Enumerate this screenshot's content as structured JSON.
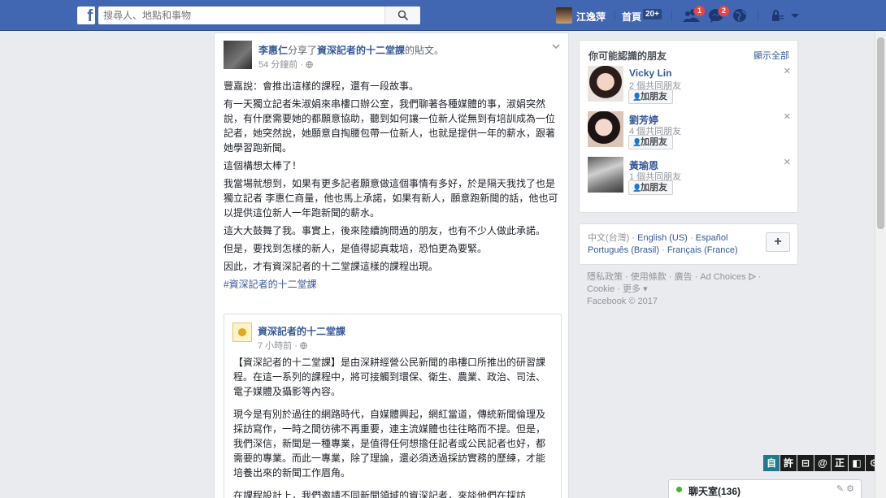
{
  "topbar": {
    "logo": "f",
    "search_placeholder": "搜尋人、地點和事物",
    "user_name": "江逸萍",
    "home_label": "首頁",
    "home_count": "20+",
    "friend_requests_count": "1",
    "messages_count": "2"
  },
  "post": {
    "author": "李惠仁",
    "shared_text": "分享了",
    "shared_page": "資深記者的十二堂課",
    "shared_suffix": "的貼文。",
    "time": "54 分鐘前 · ",
    "paragraphs": [
      "豐嘉說：會推出這樣的課程，還有一段故事。",
      "有一天獨立記者朱淑娟來串樓口辦公室，我們聊著各種媒體的事，淑娟突然說，有什麼需要她的都願意協助，聽到如何讓一位新人從無到有培訓成為一位記者，她突然說，她願意自掏腰包帶一位新人，也就是提供一年的薪水，跟著她學習跑新聞。",
      "這個構想太棒了！",
      "我當場就想到，如果有更多記者願意做這個事情有多好，於是隔天我找了也是獨立記者 李惠仁商量，他也馬上承諾，如果有新人，願意跑新聞的話，他也可以提供這位新人一年跑新聞的薪水。",
      "這大大鼓舞了我。事實上，後來陸續詢問過的朋友，也有不少人做此承諾。",
      "但是，要找到怎樣的新人，是值得認真栽培，恐怕更為要緊。",
      "因此，才有資深記者的十二堂課這樣的課程出現。"
    ],
    "hashtag": "#資深記者的十二堂課"
  },
  "shared": {
    "page_name": "資深記者的十二堂課",
    "time": "7 小時前 · ",
    "paragraphs": [
      "【資深記者的十二堂課】是由深耕經營公民新聞的串樓口所推出的研習課程。在這一系列的課程中，將可接觸到環保、衛生、農業、政治、司法、電子媒體及攝影等內容。",
      "現今是有別於過往的網路時代，自媒體興起，網紅當道，傳統新聞倫理及採訪寫作，一時之間彷彿不再重要，連主流媒體也往往略而不提。但是，我們深信，新聞是一種專業，是值得任何想擔任記者或公民記者也好，都需要的專業。而此一專業，除了理論，還必須透過採訪實務的歷練，才能培養出來的新聞工作眉角。",
      "在課程設計上，我們邀請不同新聞領域的資深記者，來談他們在採訪"
    ]
  },
  "pymk": {
    "title": "你可能認識的朋友",
    "see_all": "顯示全部",
    "add_label": "加朋友",
    "friends": [
      {
        "name": "Vicky Lin",
        "mutual": "2 個共同朋友"
      },
      {
        "name": "劉芳婷",
        "mutual": "4 個共同朋友"
      },
      {
        "name": "黃瑜恩",
        "mutual": "1 個共同朋友"
      }
    ]
  },
  "languages": {
    "current": "中文(台灣)",
    "options": [
      "English (US)",
      "Español",
      "Português (Brasil)",
      "Français (France)"
    ],
    "more": "+"
  },
  "footer": {
    "links": [
      "隱私政策",
      "使用條款",
      "廣告",
      "Ad Choices",
      "Cookie",
      "更多"
    ],
    "copyright": "Facebook © 2017"
  },
  "ime": [
    "自",
    "許",
    "⊟",
    "@",
    "正",
    "◧",
    "⚙"
  ],
  "chat": {
    "label": "聊天室(136)"
  }
}
